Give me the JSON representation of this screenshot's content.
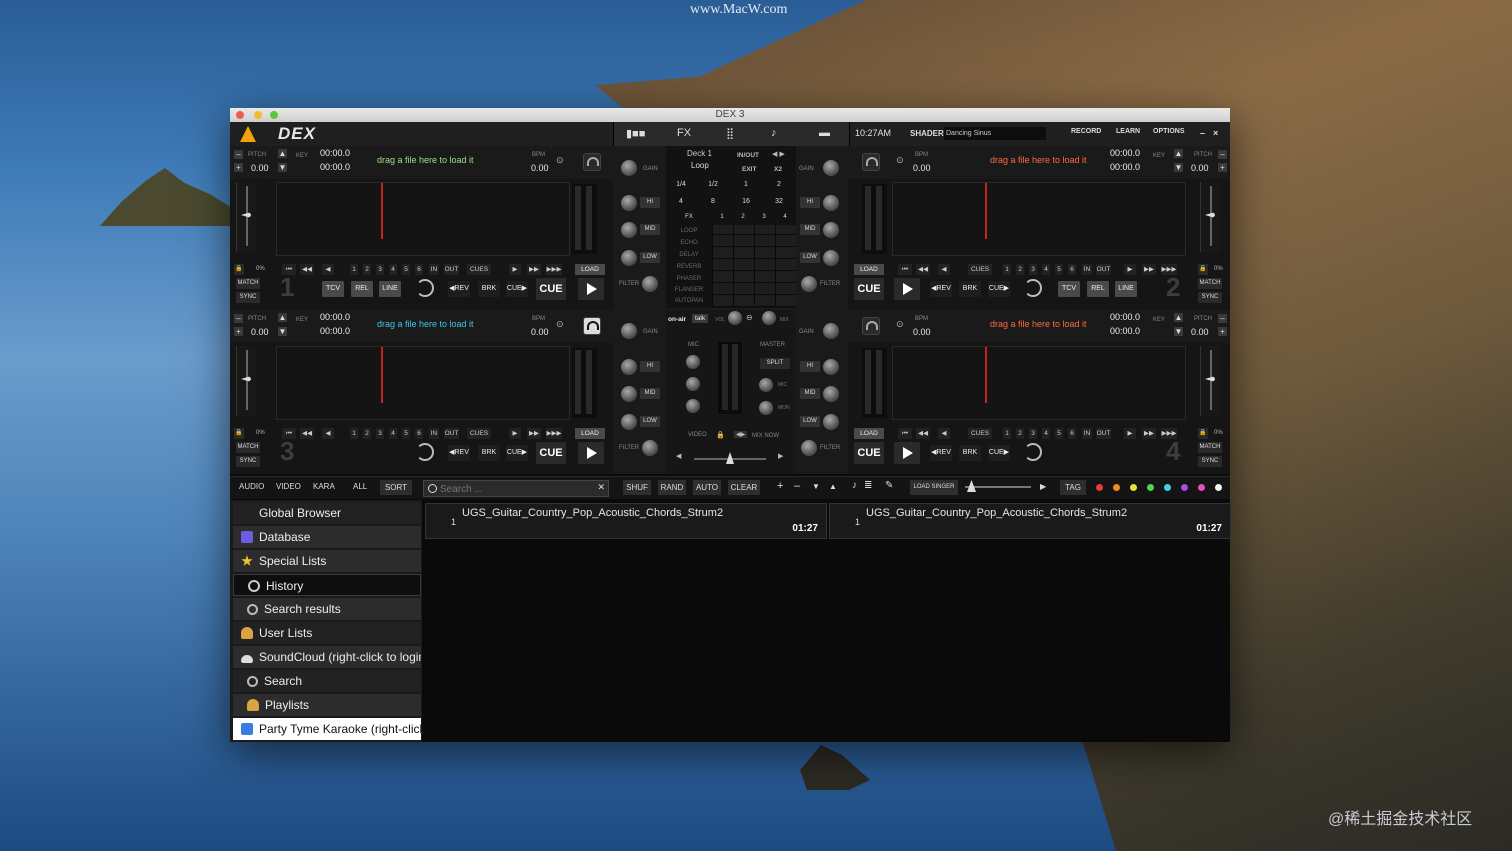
{
  "watermark": {
    "top": "www.MacW.com",
    "bottom": "@稀土掘金技术社区"
  },
  "window": {
    "title": "DEX 3"
  },
  "topbar": {
    "logo": "DEX",
    "center": [
      "FX"
    ],
    "clock": "10:27AM",
    "shader_label": "SHADER",
    "shader_value": "Dancing Sinus",
    "buttons": [
      "RECORD",
      "LEARN",
      "OPTIONS"
    ],
    "win_controls": [
      "–",
      "×"
    ]
  },
  "deck": {
    "pitch_label": "PITCH",
    "pitch_value": "0.00",
    "key_label": "KEY",
    "time_a": "00:00.0",
    "time_b": "00:00.0",
    "bpm_label": "BPM",
    "bpm_value": "0.00",
    "hint": "drag a file here to load it",
    "percent": "0%",
    "match": "MATCH",
    "sync": "SYNC",
    "hotcues": [
      "1",
      "2",
      "3",
      "4",
      "5",
      "6"
    ],
    "in": "IN",
    "out": "OUT",
    "cues": "CUES",
    "load": "LOAD",
    "tcv": "TCV",
    "rel": "REL",
    "line": "LINE",
    "rev": "◀REV",
    "brk": "BRK",
    "cue_small": "CUE▶",
    "cue": "CUE",
    "numbers": [
      "1",
      "2",
      "3",
      "4"
    ]
  },
  "mixer": {
    "gain": "GAIN",
    "hi": "HI",
    "mid": "MID",
    "low": "LOW",
    "filter": "FILTER",
    "deck_label": "Deck 1",
    "loop_label": "Loop",
    "inout": "IN/OUT",
    "exit": "EXIT",
    "x2": "X2",
    "loop_sizes": [
      "1/4",
      "1/2",
      "1",
      "2",
      "4",
      "8",
      "16",
      "32"
    ],
    "fx_label": "FX",
    "fx_slots": [
      "1",
      "2",
      "3",
      "4"
    ],
    "fx_list": [
      "LOOP",
      "ECHO",
      "DELAY",
      "REVERB",
      "PHASER",
      "FLANGER",
      "AUTOPAN"
    ],
    "on_air": "on-air",
    "talk": "talk",
    "vol": "VOL",
    "mix": "MIX",
    "mic": "MIC",
    "master": "MASTER",
    "split": "SPLIT",
    "mon": "MON",
    "video": "VIDEO",
    "mix_now": "MIX NOW"
  },
  "browse_bar": {
    "filters": [
      "AUDIO",
      "VIDEO",
      "KARA",
      "ALL",
      "SORT"
    ],
    "search_placeholder": "Search ...",
    "queue_buttons": [
      "SHUF",
      "RAND",
      "AUTO",
      "CLEAR"
    ],
    "arrows": [
      "+",
      "–",
      "▼",
      "▲"
    ],
    "load_singer": "LOAD SINGER",
    "tag": "TAG",
    "tag_colors": [
      "#e63c3c",
      "#f28a1e",
      "#e8e03a",
      "#4fd64f",
      "#3ad3e8",
      "#a84ce8",
      "#e84cc4",
      "#f2f2f2"
    ]
  },
  "sidebar": [
    {
      "label": "Global Browser",
      "icon": "globe-icon",
      "color": "#3a6fd8"
    },
    {
      "label": "Database",
      "icon": "database-icon",
      "color": "#6b5de0"
    },
    {
      "label": "Special Lists",
      "icon": "star-icon",
      "color": "#f2c22e"
    },
    {
      "label": "History",
      "icon": "clock-icon",
      "color": "#cccccc"
    },
    {
      "label": "Search results",
      "icon": "magnifier-icon",
      "color": "#bbbbbb"
    },
    {
      "label": "User Lists",
      "icon": "user-icon",
      "color": "#d9a441"
    },
    {
      "label": "SoundCloud (right-click to login)",
      "icon": "cloud-icon",
      "color": "#dddddd"
    },
    {
      "label": "Search",
      "icon": "magnifier-icon",
      "color": "#bbbbbb"
    },
    {
      "label": "Playlists",
      "icon": "user-icon",
      "color": "#d9a441"
    },
    {
      "label": "Party Tyme Karaoke (right-click to",
      "icon": "karaoke-icon",
      "color": "#3a7de0"
    }
  ],
  "tracks": [
    {
      "num": "1",
      "title": "UGS_Guitar_Country_Pop_Acoustic_Chords_Strum2",
      "duration": "01:27"
    },
    {
      "num": "1",
      "title": "UGS_Guitar_Country_Pop_Acoustic_Chords_Strum2",
      "duration": "01:27"
    }
  ]
}
